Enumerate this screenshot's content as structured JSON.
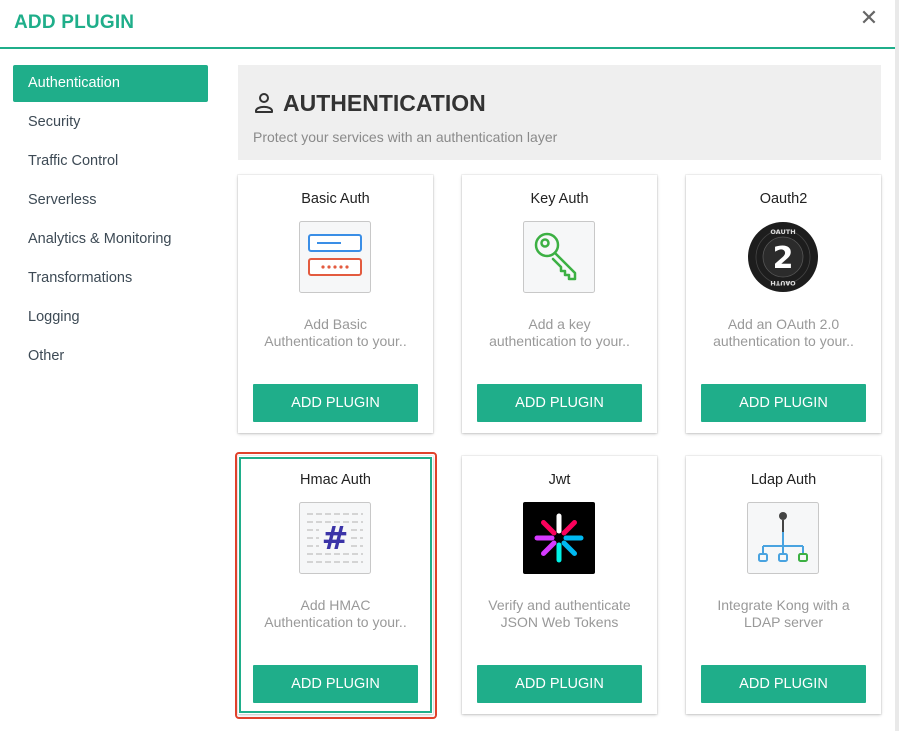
{
  "header": {
    "title": "ADD PLUGIN",
    "close_glyph": "✕"
  },
  "sidebar": {
    "items": [
      {
        "label": "Authentication",
        "active": true
      },
      {
        "label": "Security"
      },
      {
        "label": "Traffic Control"
      },
      {
        "label": "Serverless"
      },
      {
        "label": "Analytics & Monitoring"
      },
      {
        "label": "Transformations"
      },
      {
        "label": "Logging"
      },
      {
        "label": "Other"
      }
    ]
  },
  "section": {
    "title": "AUTHENTICATION",
    "subtitle": "Protect your services with an authentication layer",
    "icon": "user-icon"
  },
  "cards": [
    {
      "title": "Basic Auth",
      "icon": "basic-auth-logo",
      "desc": [
        "Add Basic",
        "Authentication to your.."
      ],
      "button": "ADD PLUGIN"
    },
    {
      "title": "Key Auth",
      "icon": "key-icon",
      "desc": [
        "Add a key",
        "authentication to your.."
      ],
      "button": "ADD PLUGIN"
    },
    {
      "title": "Oauth2",
      "icon": "oauth2-logo",
      "logo_text": "2",
      "logo_ring_text": "OAUTH",
      "desc": [
        "Add an OAuth 2.0",
        "authentication to your.."
      ],
      "button": "ADD PLUGIN"
    },
    {
      "title": "Hmac Auth",
      "icon": "hmac-hash-logo",
      "logo_text": "#",
      "desc": [
        "Add HMAC",
        "Authentication to your.."
      ],
      "button": "ADD PLUGIN",
      "selected": true
    },
    {
      "title": "Jwt",
      "icon": "jwt-logo",
      "desc": [
        "Verify and authenticate",
        "JSON Web Tokens"
      ],
      "button": "ADD PLUGIN"
    },
    {
      "title": "Ldap Auth",
      "icon": "ldap-tree-logo",
      "desc": [
        "Integrate Kong with a",
        "LDAP server"
      ],
      "button": "ADD PLUGIN"
    }
  ],
  "colors": {
    "accent": "#1fae8a",
    "highlight": "#e0412b",
    "sidebar_text": "#3d4a55",
    "desc_text": "#999999"
  }
}
